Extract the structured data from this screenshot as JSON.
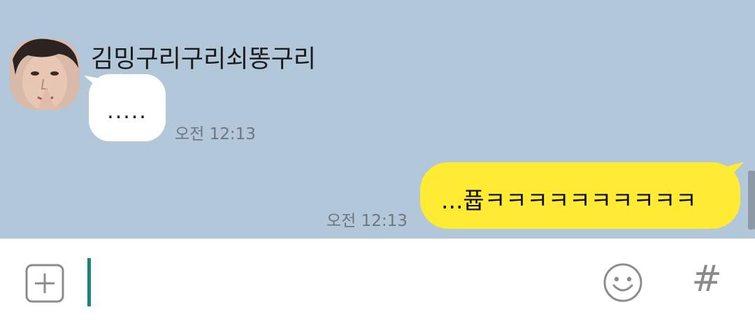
{
  "chat": {
    "background_color": "#b2c7d9",
    "incoming": {
      "sender_name": "김밍구리구리쇠똥구리",
      "text": ".....",
      "time": "오전 12:13",
      "bubble_color": "#ffffff"
    },
    "outgoing": {
      "text": "...퓹ㅋㅋㅋㅋㅋㅋㅋㅋㅋㅋ",
      "time": "오전 12:13",
      "bubble_color": "#ffeb33"
    }
  },
  "input_bar": {
    "message_value": "",
    "plus_icon": "plus-square-icon",
    "emoji_icon": "smiley-icon",
    "hash_label": "#"
  }
}
